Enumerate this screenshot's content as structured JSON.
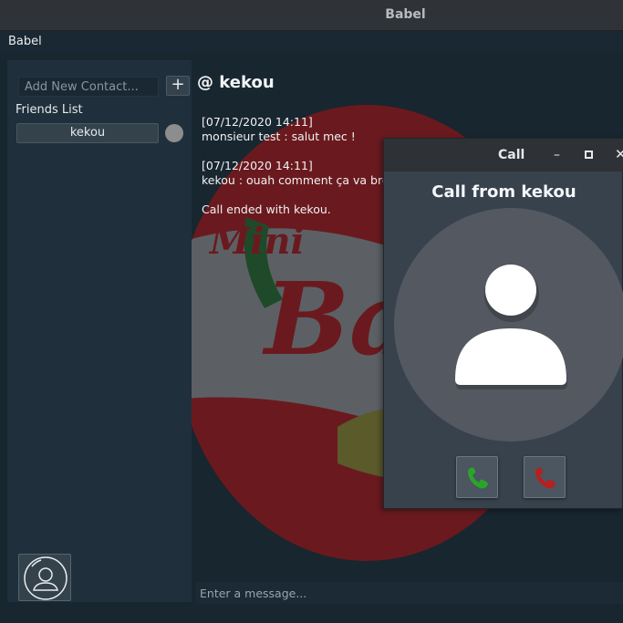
{
  "window": {
    "title": "Babel"
  },
  "menu": {
    "app_label": "Babel"
  },
  "sidebar": {
    "add_contact_placeholder": "Add New Contact...",
    "add_button_label": "+",
    "friends_label": "Friends List",
    "friends": [
      {
        "name": "kekou",
        "status_color": "#8d8d8d"
      }
    ]
  },
  "chat": {
    "title": "@ kekou",
    "messages": [
      {
        "timestamp": "[07/12/2020 14:11]",
        "text": "monsieur test : salut mec !"
      },
      {
        "timestamp": "[07/12/2020 14:11]",
        "text": "kekou : ouah comment ça va bro ?"
      },
      {
        "text": "Call ended with kekou."
      }
    ],
    "input_placeholder": "Enter a message..."
  },
  "call_window": {
    "title": "Call",
    "heading": "Call from kekou",
    "accept_icon": "phone-icon",
    "decline_icon": "phone-icon",
    "accept_color": "#2aa52a",
    "decline_color": "#b52020"
  }
}
